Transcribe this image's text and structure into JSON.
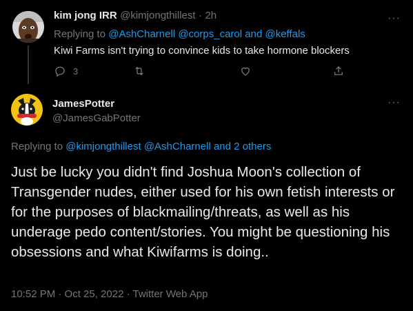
{
  "tweet1": {
    "display_name": "kim jong IRR",
    "handle": "@kimjongthillest",
    "separator": "·",
    "time": "2h",
    "replying_prefix": "Replying to",
    "replying_users": [
      "@AshCharnell",
      "@corps_carol"
    ],
    "replying_and": "and",
    "replying_last": "@keffals",
    "text": "Kiwi Farms isn't trying to convince kids to take hormone blockers",
    "reply_count": "3",
    "more": "···",
    "avatar_icon": "profile-photo-man"
  },
  "tweet2": {
    "display_name": "JamesPotter",
    "handle": "@JamesGabPotter",
    "more": "···",
    "replying_prefix": "Replying to",
    "replying_users": [
      "@kimjongthillest",
      "@AshCharnell"
    ],
    "replying_others": "and 2 others",
    "text": "Just be lucky you didn't find Joshua Moon's collection of Transgender nudes, either used for his own fetish interests or for the purposes of blackmailing/threats, as well as his underage pedo content/stories. You might be questioning his obsessions and what Kiwifarms is doing..",
    "timestamp": "10:52 PM · Oct 25, 2022 · Twitter Web App",
    "avatar_icon": "profile-photo-dog"
  },
  "colors": {
    "background": "#000000",
    "text": "#e7e9ea",
    "muted": "#71767b",
    "link": "#1d9bf0",
    "thread_line": "#333639"
  }
}
